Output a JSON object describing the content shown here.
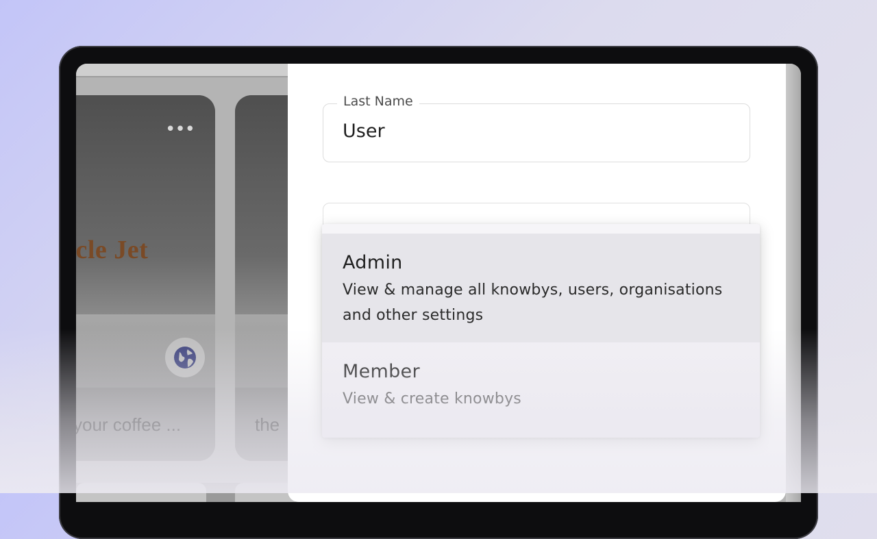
{
  "colors": {
    "background_start": "#c3c5f8",
    "background_end": "#e6e4ec",
    "device_bezel": "#0d0d0f",
    "panel_bg": "#ffffff",
    "menu_bg": "#f1eff4",
    "selected_option_bg": "#e6e5ea",
    "globe_icon": "#3a3f7a"
  },
  "background_app": {
    "cards": [
      {
        "brand_text": "acle Jet",
        "caption": "your coffee ...",
        "icons": [
          "more-horizontal-icon",
          "globe-icon"
        ]
      },
      {
        "caption": "the"
      }
    ]
  },
  "form": {
    "last_name": {
      "label": "Last Name",
      "value": "User"
    }
  },
  "role_menu": {
    "options": [
      {
        "title": "Admin",
        "description": "View & manage all knowbys, users, organisations and other settings",
        "highlighted": true
      },
      {
        "title": "Member",
        "description": "View & create knowbys",
        "highlighted": false
      }
    ]
  }
}
